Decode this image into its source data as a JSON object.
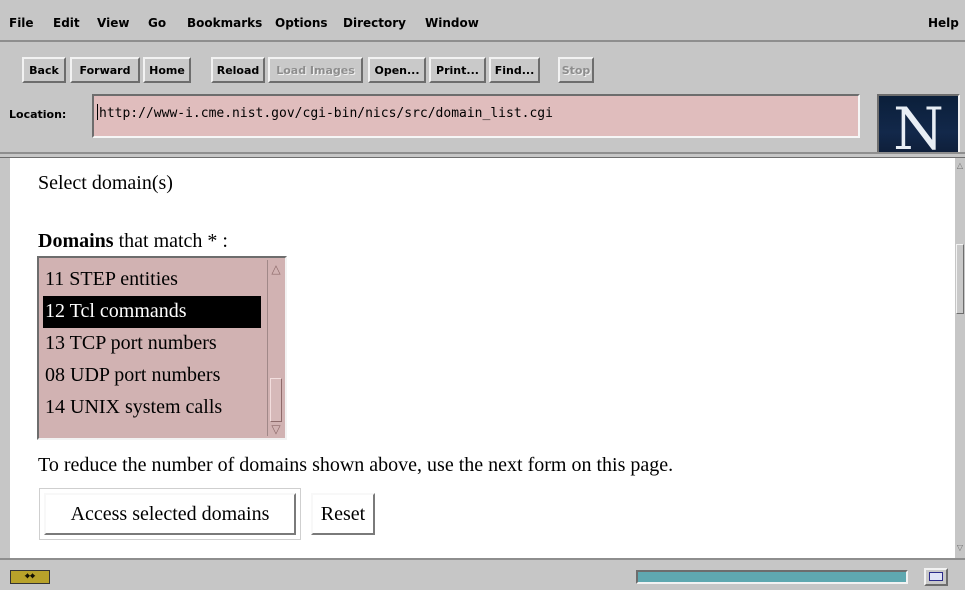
{
  "menu": {
    "items": [
      "File",
      "Edit",
      "View",
      "Go",
      "Bookmarks",
      "Options",
      "Directory",
      "Window"
    ],
    "help": "Help"
  },
  "toolbar": {
    "back": "Back",
    "forward": "Forward",
    "home": "Home",
    "reload": "Reload",
    "load_images": "Load Images",
    "open": "Open...",
    "print": "Print...",
    "find": "Find...",
    "stop": "Stop"
  },
  "location": {
    "label": "Location:",
    "url": "http://www-i.cme.nist.gov/cgi-bin/nics/src/domain_list.cgi"
  },
  "logo": {
    "letter": "N"
  },
  "page": {
    "heading": "Select domain(s)",
    "domains_bold": "Domains",
    "domains_rest": " that match * :",
    "domain_list": [
      {
        "label": "11 STEP entities",
        "selected": false
      },
      {
        "label": "12 Tcl commands",
        "selected": true
      },
      {
        "label": "13 TCP port numbers",
        "selected": false
      },
      {
        "label": "08 UDP port numbers",
        "selected": false
      },
      {
        "label": "14 UNIX system calls",
        "selected": false
      }
    ],
    "hint": "To reduce the number of domains shown above, use the next form on this page.",
    "access_button": "Access selected domains",
    "reset_button": "Reset"
  },
  "status": {
    "security_icon": "broken-key-icon",
    "mail_icon": "envelope-icon"
  },
  "colors": {
    "chrome": "#c6c6c6",
    "field_bg": "#e0bdbd",
    "listbox_bg": "#d1b2b2",
    "progress": "#5fa8b0"
  }
}
